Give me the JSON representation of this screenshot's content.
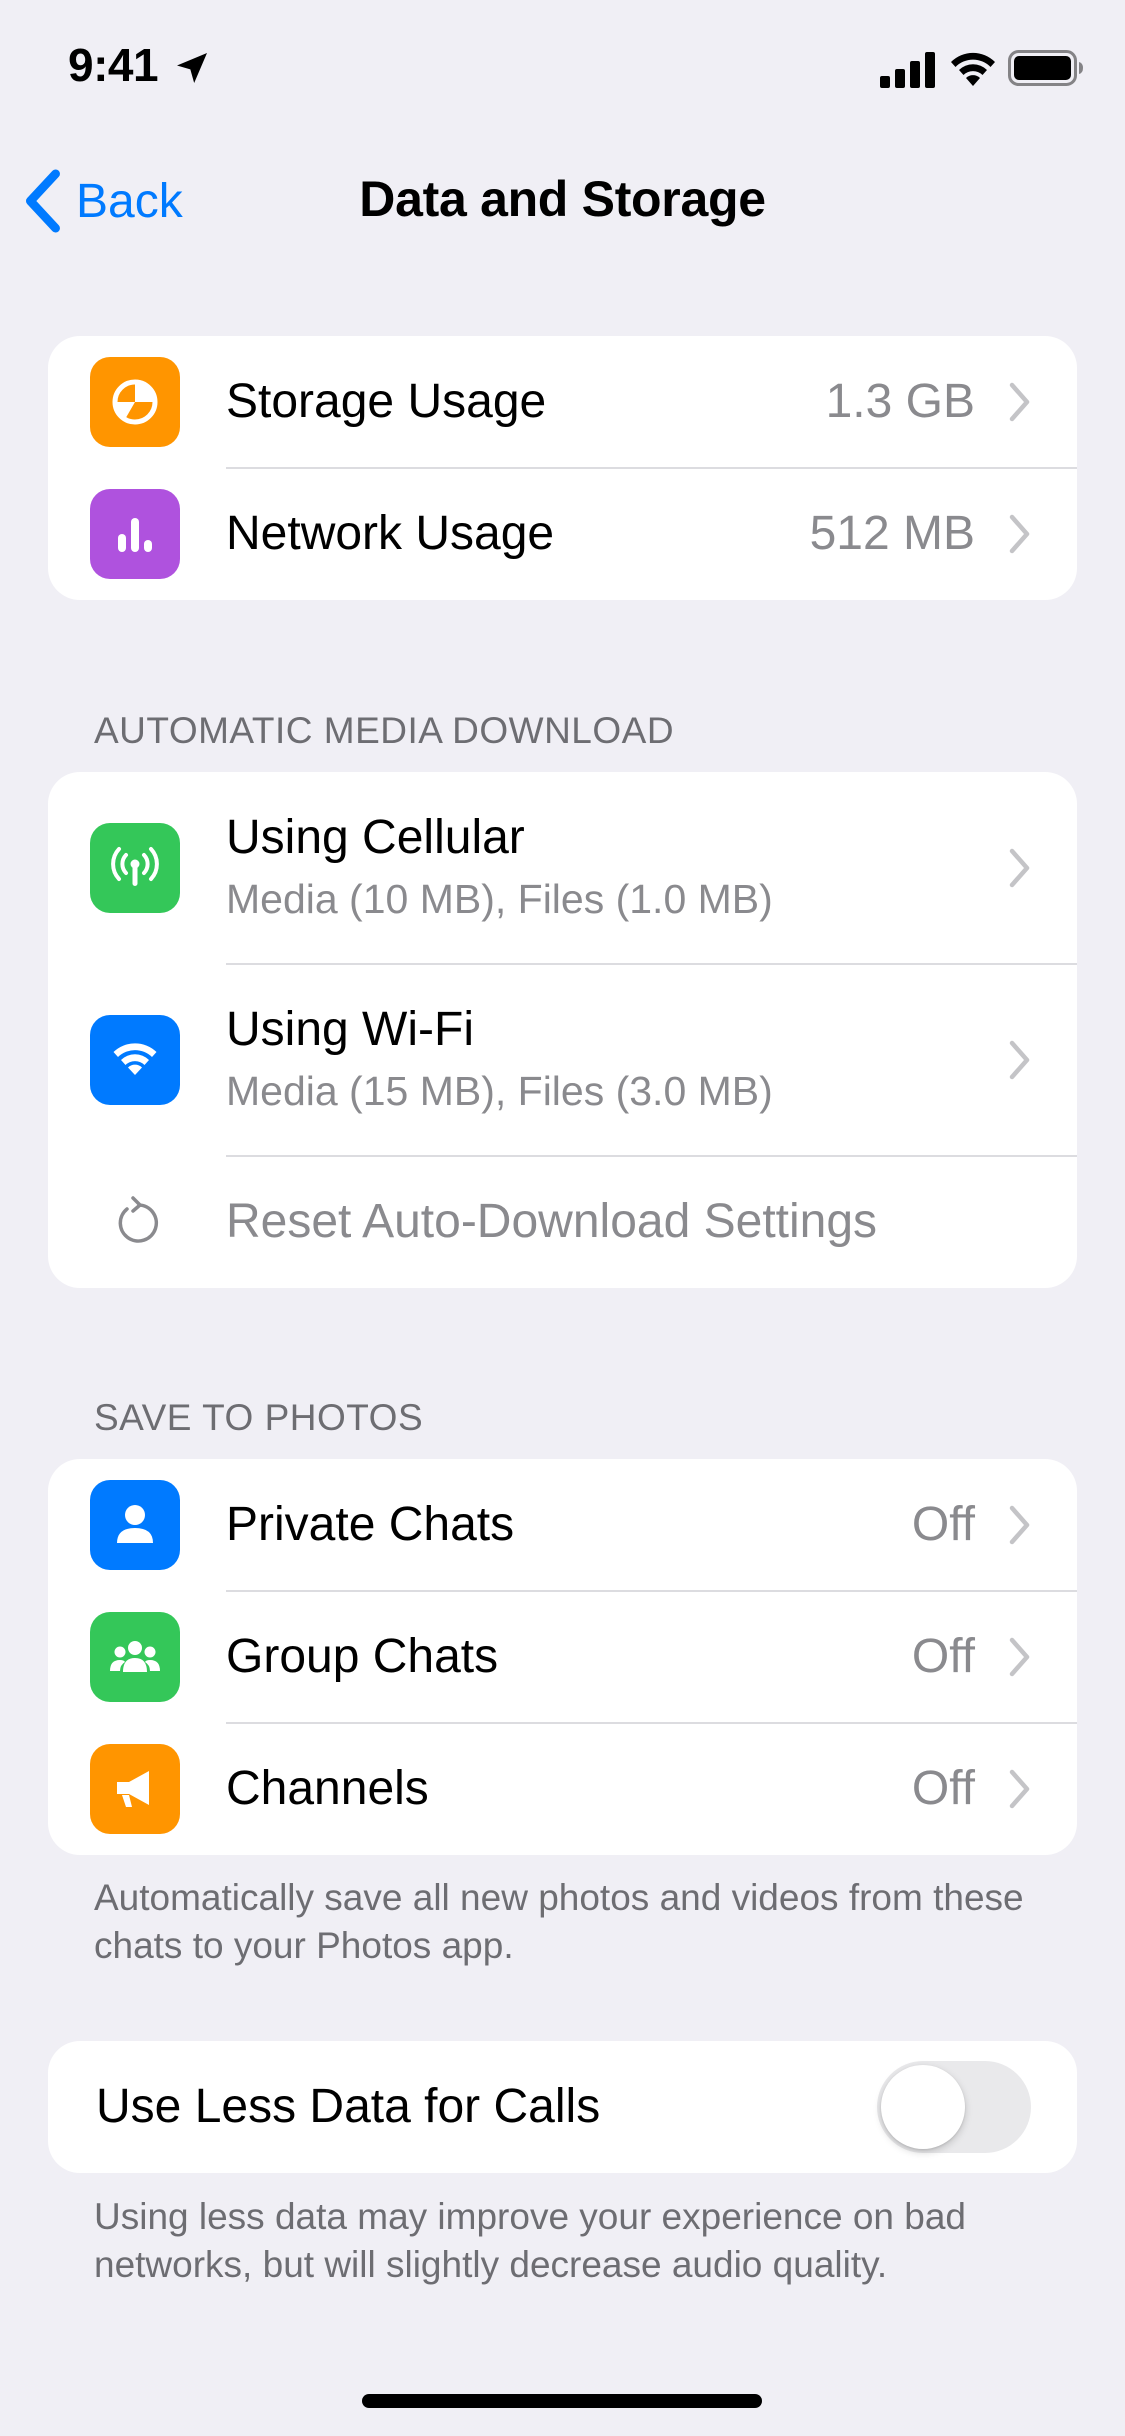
{
  "status_bar": {
    "time": "9:41"
  },
  "nav": {
    "back_label": "Back",
    "title": "Data and Storage"
  },
  "usage": {
    "items": [
      {
        "label": "Storage Usage",
        "value": "1.3 GB",
        "icon": "pie-chart-icon",
        "color": "#FF9500"
      },
      {
        "label": "Network Usage",
        "value": "512 MB",
        "icon": "bar-chart-icon",
        "color": "#AF52DE"
      }
    ]
  },
  "auto_download": {
    "header": "AUTOMATIC MEDIA DOWNLOAD",
    "items": [
      {
        "label": "Using Cellular",
        "subtitle": "Media (10 MB), Files (1.0 MB)",
        "icon": "cellular-antenna-icon",
        "color": "#34C759"
      },
      {
        "label": "Using Wi-Fi",
        "subtitle": "Media (15 MB), Files (3.0 MB)",
        "icon": "wifi-icon",
        "color": "#007AFF"
      }
    ],
    "reset_label": "Reset Auto-Download Settings"
  },
  "save_to_photos": {
    "header": "SAVE TO PHOTOS",
    "items": [
      {
        "label": "Private Chats",
        "value": "Off",
        "icon": "person-icon",
        "color": "#007AFF"
      },
      {
        "label": "Group Chats",
        "value": "Off",
        "icon": "group-icon",
        "color": "#34C759"
      },
      {
        "label": "Channels",
        "value": "Off",
        "icon": "megaphone-icon",
        "color": "#FF9500"
      }
    ],
    "footer": "Automatically save all new photos and videos from these chats to your Photos app."
  },
  "calls": {
    "label": "Use Less Data for Calls",
    "enabled": false,
    "footer": "Using less data may improve your experience on bad networks, but will slightly decrease audio quality."
  }
}
